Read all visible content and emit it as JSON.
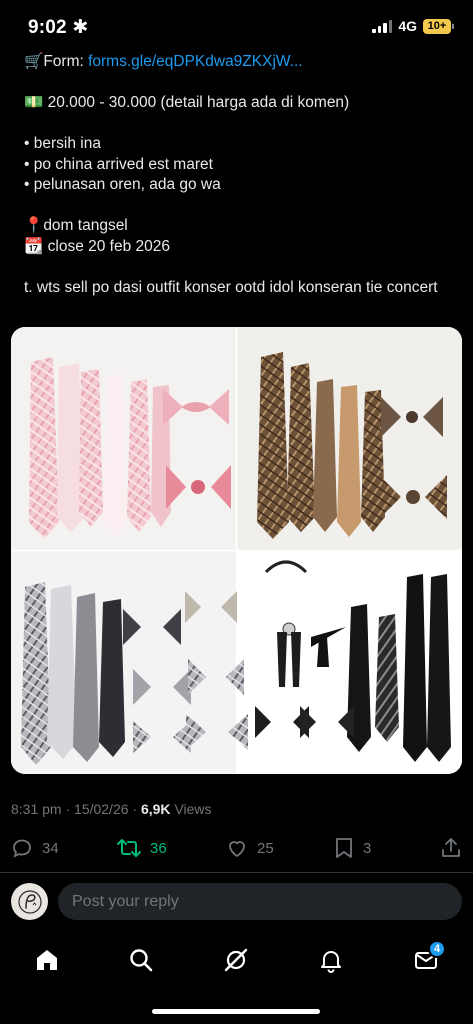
{
  "status_bar": {
    "time": "9:02",
    "dnd_symbol": "✱",
    "network": "4G",
    "battery": "10+"
  },
  "tweet": {
    "form_label": "Form:",
    "form_link": "forms.gle/eqDPKdwa9ZKXjW...",
    "price": "20.000 - 30.000 (detail harga ada di komen)",
    "bullets": [
      "bersih ina",
      "po china arrived est maret",
      "pelunasan oren, ada go wa"
    ],
    "location": "dom tangsel",
    "close_date": "close 20 feb 2026",
    "tags": "t. wts sell po dasi outfit konser ootd idol konseran tie concert",
    "emoji": {
      "cart": "🛒",
      "money": "💵",
      "pin": "📍",
      "calendar": "📆"
    }
  },
  "meta": {
    "time_date": "8:31 pm · 15/02/26 ·",
    "views_count": "6,9K",
    "views_label": "Views"
  },
  "actions": {
    "replies": "34",
    "reposts": "36",
    "likes": "25",
    "bookmarks": "3"
  },
  "reply": {
    "placeholder": "Post your reply"
  },
  "nav": {
    "notifications_badge": "4"
  },
  "colors": {
    "link": "#1d9bf0",
    "repost_active": "#00ba7c",
    "muted": "#71767b"
  },
  "icons": [
    "home-icon",
    "search-icon",
    "grok-icon",
    "bell-icon",
    "mail-icon",
    "reply-icon",
    "repost-icon",
    "heart-icon",
    "bookmark-icon",
    "share-icon"
  ]
}
